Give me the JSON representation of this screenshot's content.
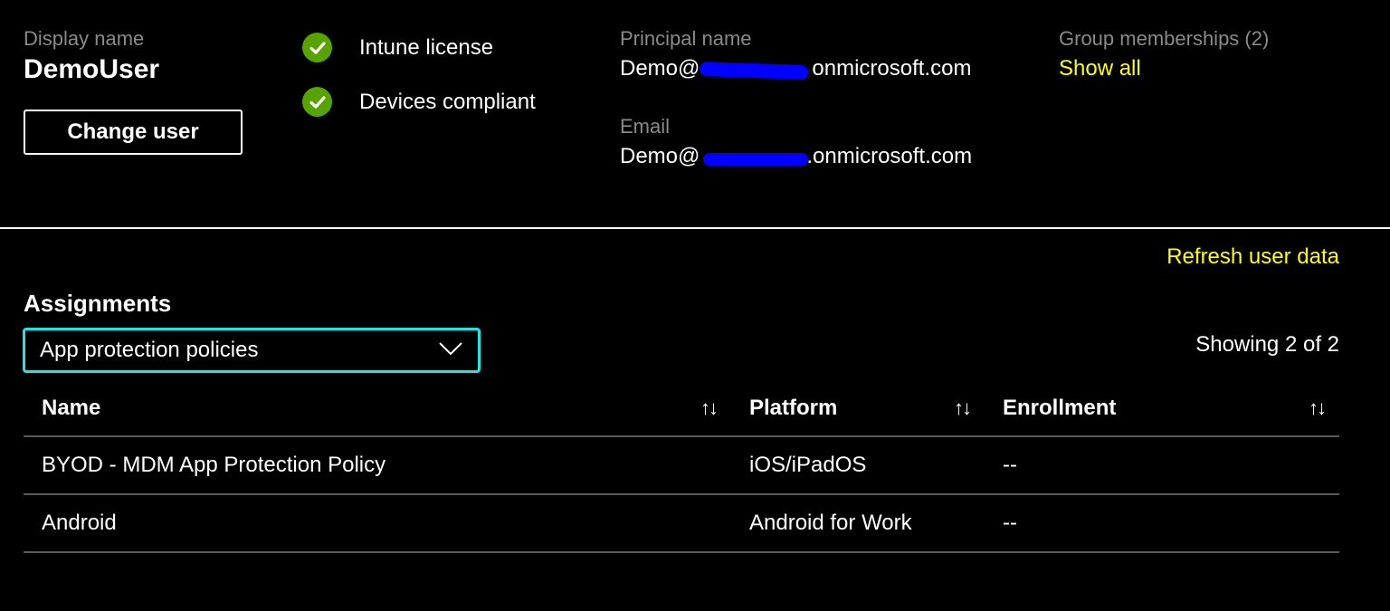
{
  "user": {
    "display_name_label": "Display name",
    "display_name": "DemoUser",
    "change_user_label": "Change user"
  },
  "status": {
    "items": [
      {
        "label": "Intune license",
        "icon": "checkmark-icon",
        "color": "#57a300"
      },
      {
        "label": "Devices compliant",
        "icon": "checkmark-icon",
        "color": "#57a300"
      }
    ]
  },
  "principal": {
    "label": "Principal name",
    "value_prefix": "Demo@",
    "value_suffix": "onmicrosoft.com"
  },
  "email": {
    "label": "Email",
    "value_prefix": "Demo@",
    "value_suffix": ".onmicrosoft.com"
  },
  "groups": {
    "label": "Group memberships (2)",
    "show_all": "Show all"
  },
  "refresh_label": "Refresh user data",
  "assignments": {
    "title": "Assignments",
    "dropdown_value": "App protection policies",
    "showing": "Showing 2 of 2"
  },
  "table": {
    "headers": [
      "Name",
      "Platform",
      "Enrollment"
    ],
    "sort_icon": "↑↓",
    "rows": [
      [
        "BYOD - MDM App Protection Policy",
        "iOS/iPadOS",
        "--"
      ],
      [
        "Android",
        "Android for Work",
        "--"
      ]
    ]
  },
  "colors": {
    "accent_link": "#ffff00",
    "focus_border": "#19e6e6",
    "check_green": "#57a300",
    "redaction": "#0000ff"
  }
}
